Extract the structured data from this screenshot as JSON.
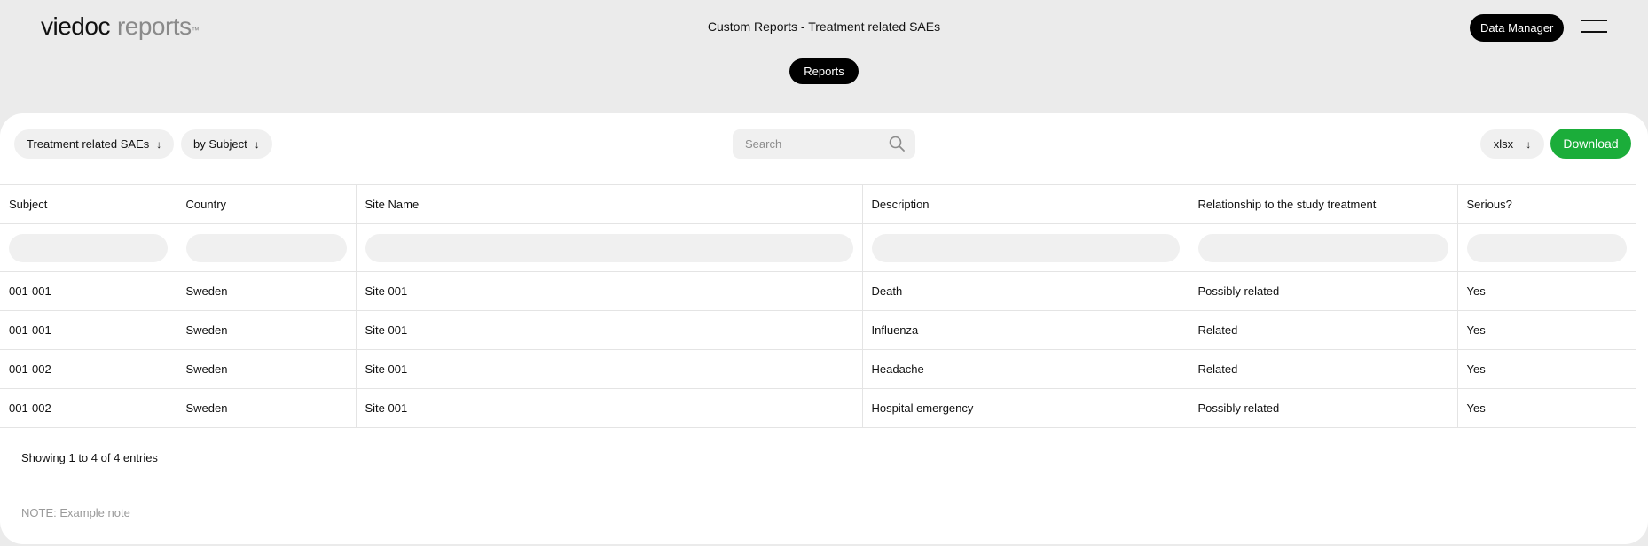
{
  "header": {
    "logo_brand": "viedoc",
    "logo_product": "reports",
    "logo_tm": "™",
    "page_title": "Custom Reports - Treatment related SAEs",
    "role_button": "Data Manager",
    "menu_icon": "hamburger-menu-icon",
    "nav_pill": "Reports"
  },
  "toolbar": {
    "report_select": "Treatment related SAEs",
    "grouping_select": "by Subject",
    "search_placeholder": "Search",
    "search_icon": "search-icon",
    "format_select": "xlsx",
    "download_label": "Download",
    "arrow_glyph": "↓",
    "colors": {
      "download": "#1bad3a",
      "pill": "#f0f0f0"
    }
  },
  "table": {
    "columns": [
      "Subject",
      "Country",
      "Site Name",
      "Description",
      "Relationship to the study treatment",
      "Serious?"
    ],
    "rows": [
      [
        "001-001",
        "Sweden",
        "Site 001",
        "Death",
        "Possibly related",
        "Yes"
      ],
      [
        "001-001",
        "Sweden",
        "Site 001",
        "Influenza",
        "Related",
        "Yes"
      ],
      [
        "001-002",
        "Sweden",
        "Site 001",
        "Headache",
        "Related",
        "Yes"
      ],
      [
        "001-002",
        "Sweden",
        "Site 001",
        "Hospital emergency",
        "Possibly related",
        "Yes"
      ]
    ]
  },
  "footer": {
    "entries_info": "Showing 1 to 4 of 4 entries",
    "note": "NOTE: Example note"
  }
}
